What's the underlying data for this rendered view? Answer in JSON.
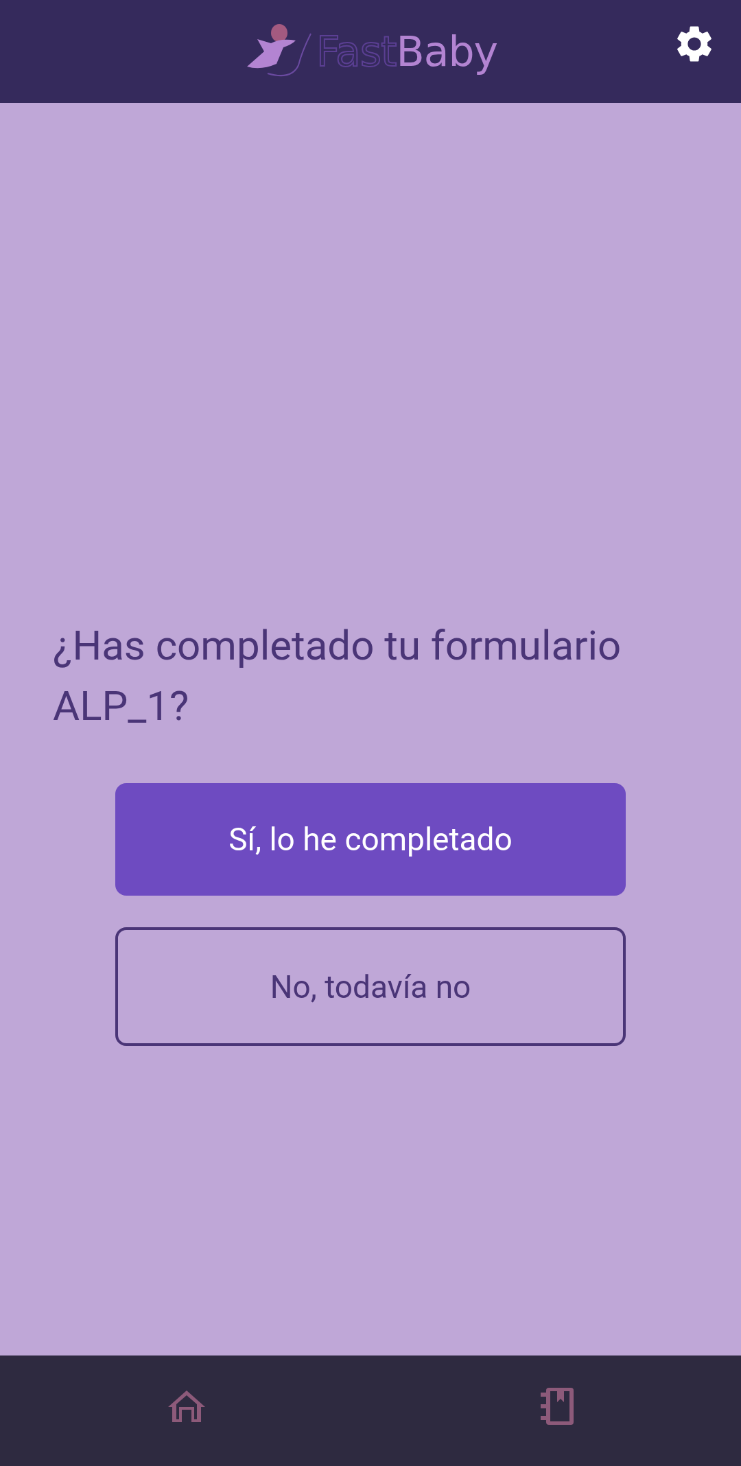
{
  "header": {
    "logo": {
      "part_1": "Fast",
      "part_2": "Baby"
    }
  },
  "question": "¿Has completado tu formulario ALP_1?",
  "buttons": [
    {
      "label": "Sí, lo he completado",
      "kind": "primary"
    },
    {
      "label": "No, todavía no",
      "kind": "outline"
    }
  ]
}
